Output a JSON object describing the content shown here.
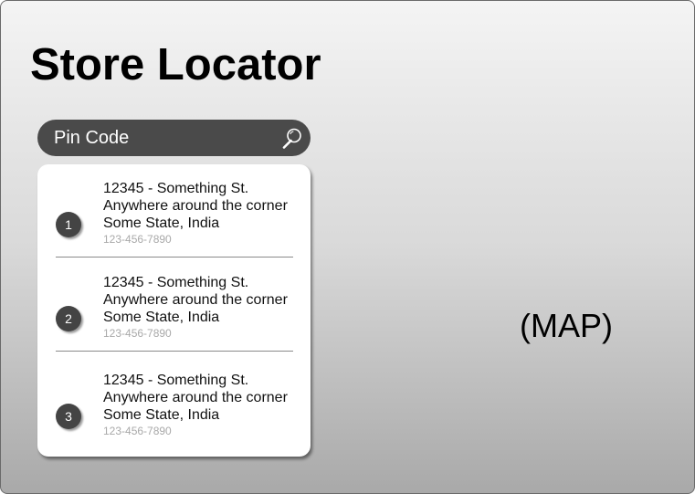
{
  "page": {
    "title": "Store Locator"
  },
  "search": {
    "placeholder": "Pin Code",
    "icon": "magnifier-icon"
  },
  "stores": [
    {
      "number": "1",
      "street": "12345 - Something St.",
      "area": "Anywhere around the corner",
      "region": "Some State, India",
      "phone": "123-456-7890"
    },
    {
      "number": "2",
      "street": "12345 - Something St.",
      "area": "Anywhere around the corner",
      "region": "Some State, India",
      "phone": "123-456-7890"
    },
    {
      "number": "3",
      "street": "12345 - Something St.",
      "area": "Anywhere around the corner",
      "region": "Some State, India",
      "phone": "123-456-7890"
    }
  ],
  "map": {
    "label": "(MAP)"
  },
  "colors": {
    "search_bar": "#4a4a4a",
    "badge": "#444444",
    "phone_text": "#a9a9a9"
  }
}
